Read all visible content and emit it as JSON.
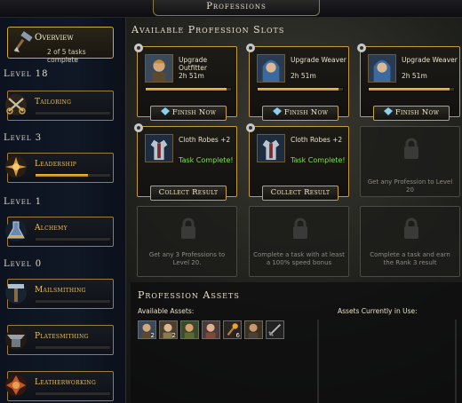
{
  "window": {
    "title": "Professions"
  },
  "sidebar": {
    "overview": {
      "title": "Overview",
      "subtitle": "2 of 5 tasks complete"
    },
    "levels": [
      "Level 18",
      "Level 3",
      "Level 1",
      "Level 0"
    ],
    "professions": [
      {
        "name": "Tailoring",
        "progress": 0.0
      },
      {
        "name": "Leadership",
        "progress": 0.7
      },
      {
        "name": "Alchemy",
        "progress": 0.0
      },
      {
        "name": "Mailsmithing",
        "progress": 0.0
      },
      {
        "name": "Platesmithing",
        "progress": 0.0
      },
      {
        "name": "Leatherworking",
        "progress": 0.0
      }
    ]
  },
  "main": {
    "slots_title": "Available Profession Slots",
    "active_slots": [
      {
        "task": "Upgrade Outfitter",
        "time": "2h 51m",
        "progress": 0.95,
        "button": "Finish Now"
      },
      {
        "task": "Upgrade Weaver",
        "time": "2h 51m",
        "progress": 0.95,
        "button": "Finish Now"
      },
      {
        "task": "Upgrade Weaver",
        "time": "2h 51m",
        "progress": 0.95,
        "button": "Finish Now"
      }
    ],
    "complete_slots": [
      {
        "task": "Cloth Robes +2",
        "status": "Task Complete!",
        "button": "Collect Result"
      },
      {
        "task": "Cloth Robes +2",
        "status": "Task Complete!",
        "button": "Collect Result"
      }
    ],
    "locked_slots": [
      {
        "text": "Get any Profession to Level 20"
      },
      {
        "text": "Get any 3 Professions to Level 20."
      },
      {
        "text": "Complete a task with at least a 100% speed bonus"
      },
      {
        "text": "Complete a task and earn the Rank 3 result"
      }
    ],
    "assets_title": "Profession Assets",
    "available_assets_label": "Available Assets:",
    "in_use_label": "Assets Currently in Use:",
    "assets": [
      {
        "icon": "portrait-outfitter-icon",
        "count": "2"
      },
      {
        "icon": "portrait-weaver-icon",
        "count": "2"
      },
      {
        "icon": "portrait-leadership-icon",
        "count": ""
      },
      {
        "icon": "portrait-leadership-icon-2",
        "count": ""
      },
      {
        "icon": "torch-icon",
        "count": "6"
      },
      {
        "icon": "portrait-smith-icon",
        "count": ""
      },
      {
        "icon": "tool-icon",
        "count": ""
      }
    ]
  },
  "colors": {
    "gold": "#c79a38",
    "progress": "#f4c24a",
    "complete": "#7fe04a"
  }
}
